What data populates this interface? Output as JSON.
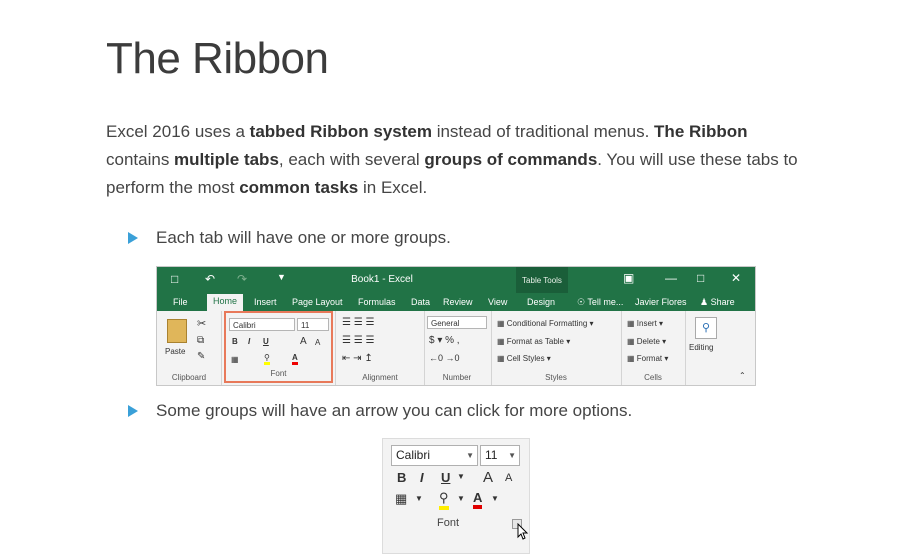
{
  "page": {
    "title": "The Ribbon",
    "intro": {
      "p1": "Excel 2016 uses a ",
      "b1": "tabbed Ribbon system",
      "p2": " instead of traditional menus. ",
      "b2": "The Ribbon",
      "p3": " contains ",
      "b3": "multiple tabs",
      "p4": ", each with several ",
      "b4": "groups of commands",
      "p5": ". You will use these tabs to perform the most ",
      "b5": "common tasks",
      "p6": " in Excel."
    },
    "bullets": [
      "Each tab will have one or more groups.",
      "Some groups will have an arrow you can click for more options."
    ]
  },
  "ribbon": {
    "window_title": "Book1 - Excel",
    "table_tools": "Table Tools",
    "tabs": [
      "File",
      "Home",
      "Insert",
      "Page Layout",
      "Formulas",
      "Data",
      "Review",
      "View",
      "Design"
    ],
    "tell_me": "Tell me...",
    "user": "Javier Flores",
    "share": "Share",
    "groups": {
      "clipboard": "Clipboard",
      "font": "Font",
      "alignment": "Alignment",
      "number": "Number",
      "styles": "Styles",
      "cells": "Cells",
      "editing": "Editing"
    },
    "paste": "Paste",
    "font_name": "Calibri",
    "font_size": "11",
    "number_format": "General",
    "styles_items": [
      "Conditional Formatting",
      "Format as Table",
      "Cell Styles"
    ],
    "cells_items": [
      "Insert",
      "Delete",
      "Format"
    ]
  },
  "font_zoom": {
    "font_name": "Calibri",
    "font_size": "11",
    "label": "Font"
  },
  "colors": {
    "excel_green": "#217346",
    "highlight_border": "#e8795a",
    "bullet": "#3aa0d8"
  }
}
